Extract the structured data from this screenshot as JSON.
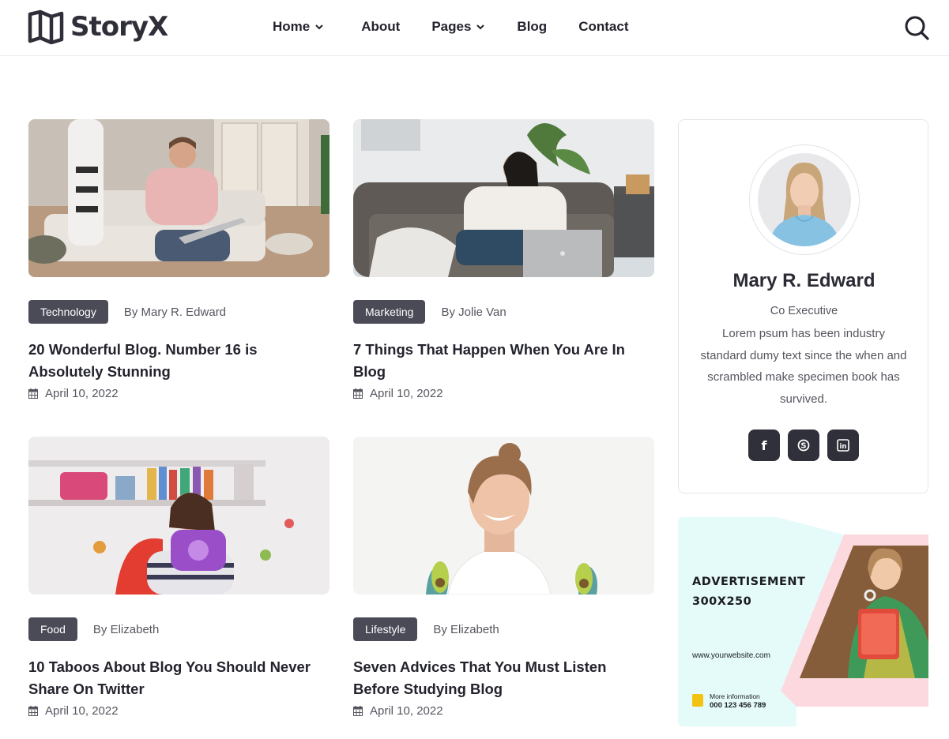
{
  "brand": {
    "name": "StoryX"
  },
  "nav": {
    "items": [
      {
        "label": "Home",
        "has_dropdown": true
      },
      {
        "label": "About",
        "has_dropdown": false
      },
      {
        "label": "Pages",
        "has_dropdown": true
      },
      {
        "label": "Blog",
        "has_dropdown": false
      },
      {
        "label": "Contact",
        "has_dropdown": false
      }
    ]
  },
  "posts": [
    {
      "category": "Technology",
      "author": "By Mary R. Edward",
      "title": "20 Wonderful Blog. Number 16 is Absolutely Stunning",
      "date": "April 10, 2022"
    },
    {
      "category": "Marketing",
      "author": "By Jolie Van",
      "title": "7 Things That Happen When You Are In Blog",
      "date": "April 10, 2022"
    },
    {
      "category": "Food",
      "author": "By Elizabeth",
      "title": "10 Taboos About Blog You Should Never Share On Twitter",
      "date": "April 10, 2022"
    },
    {
      "category": "Lifestyle",
      "author": "By Elizabeth",
      "title": "Seven Advices That You Must Listen Before Studying Blog",
      "date": "April 10, 2022"
    }
  ],
  "profile": {
    "name": "Mary R. Edward",
    "role": "Co Executive",
    "bio": "Lorem psum has been industry standard dumy text since the when and scrambled make specimen book has survived.",
    "socials": [
      {
        "icon": "facebook-icon",
        "glyph": "f"
      },
      {
        "icon": "skype-icon",
        "glyph": "S"
      },
      {
        "icon": "linkedin-icon",
        "glyph": "in"
      }
    ]
  },
  "ad": {
    "title_line1": "ADVERTISEMENT",
    "title_line2": "300X250",
    "url": "www.yourwebsite.com",
    "more_label": "More information",
    "phone": "000 123 456 789"
  },
  "colors": {
    "text": "#23232e",
    "tag_bg": "#4a4b57",
    "social_bg": "#2f3039",
    "ad_mint": "#e4fbfa",
    "ad_pink": "#fbd9de"
  }
}
